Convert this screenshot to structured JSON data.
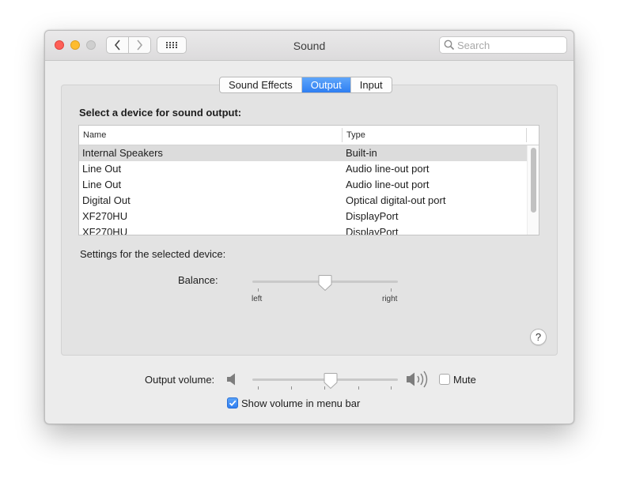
{
  "window": {
    "title": "Sound"
  },
  "toolbar": {
    "back_icon": "chevron-left-icon",
    "forward_icon": "chevron-right-icon",
    "grid_icon": "grid-icon",
    "search_placeholder": "Search",
    "search_value": ""
  },
  "tabs": [
    {
      "label": "Sound Effects",
      "active": false
    },
    {
      "label": "Output",
      "active": true
    },
    {
      "label": "Input",
      "active": false
    }
  ],
  "output": {
    "section_label": "Select a device for sound output:",
    "columns": [
      "Name",
      "Type"
    ],
    "devices": [
      {
        "name": "Internal Speakers",
        "type": "Built-in",
        "selected": true
      },
      {
        "name": "Line Out",
        "type": "Audio line-out port",
        "selected": false
      },
      {
        "name": "Line Out",
        "type": "Audio line-out port",
        "selected": false
      },
      {
        "name": "Digital Out",
        "type": "Optical digital-out port",
        "selected": false
      },
      {
        "name": "XF270HU",
        "type": "DisplayPort",
        "selected": false
      },
      {
        "name": "XF270HU",
        "type": "DisplayPort",
        "selected": false
      }
    ],
    "settings_label": "Settings for the selected device:",
    "balance": {
      "label": "Balance:",
      "left_label": "left",
      "right_label": "right",
      "value": 0.5
    }
  },
  "help": {
    "label": "?"
  },
  "volume": {
    "label": "Output volume:",
    "value": 0.54,
    "mute_label": "Mute",
    "mute_checked": false,
    "low_icon": "speaker-low-icon",
    "high_icon": "speaker-high-icon"
  },
  "menubar": {
    "label": "Show volume in menu bar",
    "checked": true
  },
  "colors": {
    "accent": "#2f7ef1",
    "close": "#fe5f57",
    "minimize": "#febc2e",
    "zoom": "#cfcfcf"
  }
}
